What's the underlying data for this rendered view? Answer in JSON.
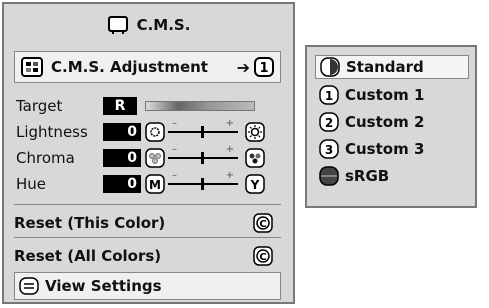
{
  "panel": {
    "title": "C.M.S.",
    "adjustment": {
      "label": "C.M.S. Adjustment",
      "arrow": "➔",
      "value": "1"
    },
    "rows": [
      {
        "label": "Target",
        "value": "R"
      },
      {
        "label": "Lightness",
        "value": "0"
      },
      {
        "label": "Chroma",
        "value": "0"
      },
      {
        "label": "Hue",
        "value": "0",
        "left_icon": "M",
        "right_icon": "Y"
      }
    ],
    "actions": [
      {
        "label": "Reset (This Color)",
        "icon": "C"
      },
      {
        "label": "Reset (All Colors)",
        "icon": "C"
      },
      {
        "label": "View Settings"
      }
    ]
  },
  "menu": {
    "items": [
      {
        "label": "Standard",
        "icon": "",
        "selected": true
      },
      {
        "label": "Custom 1",
        "icon": "1",
        "selected": false
      },
      {
        "label": "Custom 2",
        "icon": "2",
        "selected": false
      },
      {
        "label": "Custom 3",
        "icon": "3",
        "selected": false
      },
      {
        "label": "sRGB",
        "icon": "",
        "selected": false
      }
    ]
  }
}
